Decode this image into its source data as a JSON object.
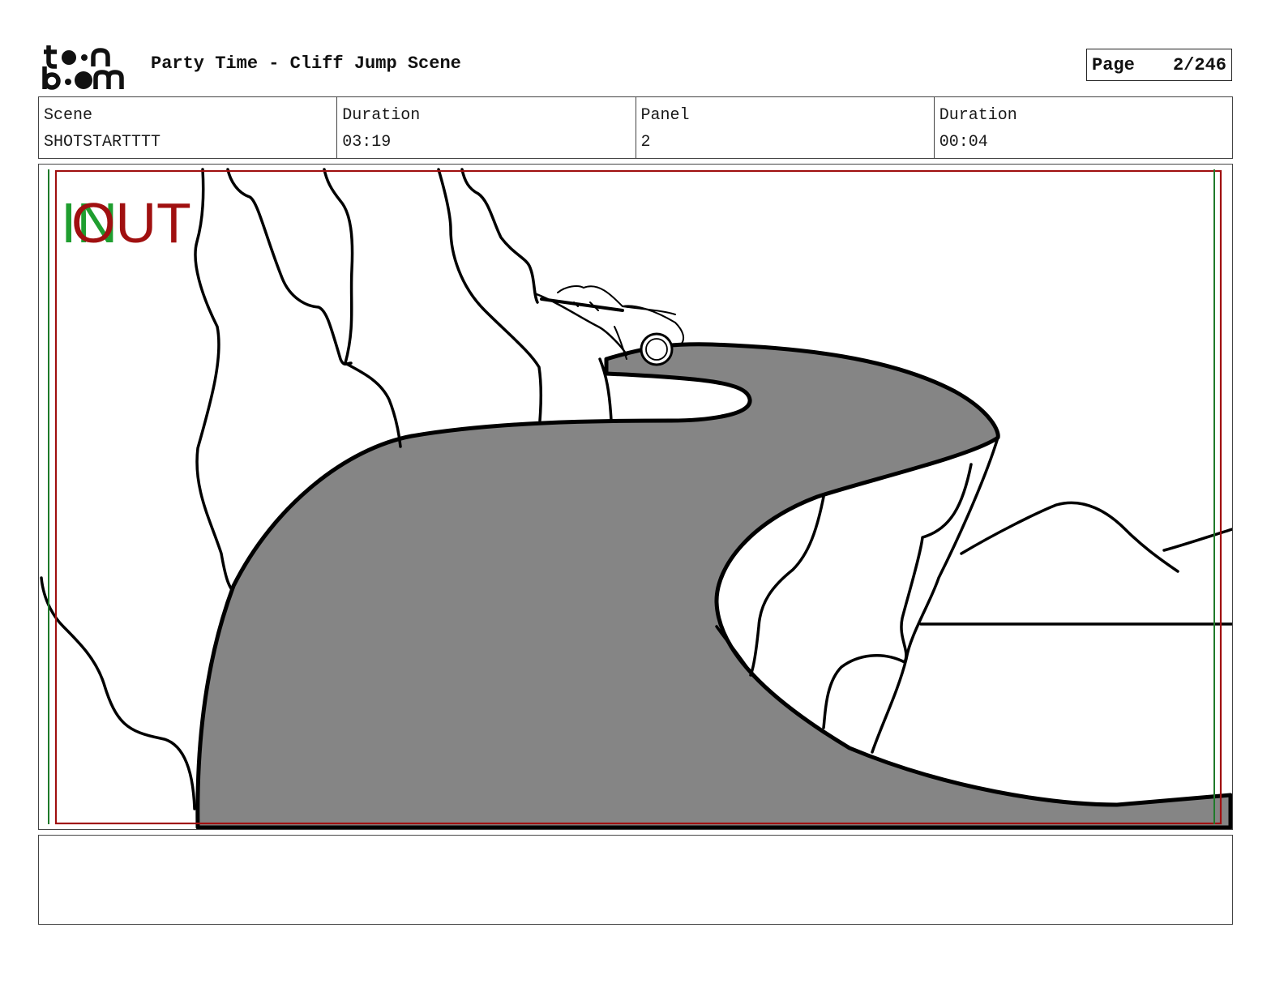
{
  "header": {
    "logo_text": "toonboom",
    "title": "Party Time - Cliff Jump Scene",
    "page_label": "Page",
    "page_value": "2/246"
  },
  "info": {
    "scene_label": "Scene",
    "scene_value": "SHOTSTARTTTT",
    "scene_duration_label": "Duration",
    "scene_duration_value": "03:19",
    "panel_label": "Panel",
    "panel_value": "2",
    "panel_duration_label": "Duration",
    "panel_duration_value": "00:04"
  },
  "panel": {
    "in_marker": "IN",
    "out_marker": "OUT",
    "colors": {
      "in": "#1f9e2f",
      "out": "#a01010",
      "road": "#858585",
      "ink": "#000000"
    }
  },
  "notes": {
    "text": ""
  }
}
